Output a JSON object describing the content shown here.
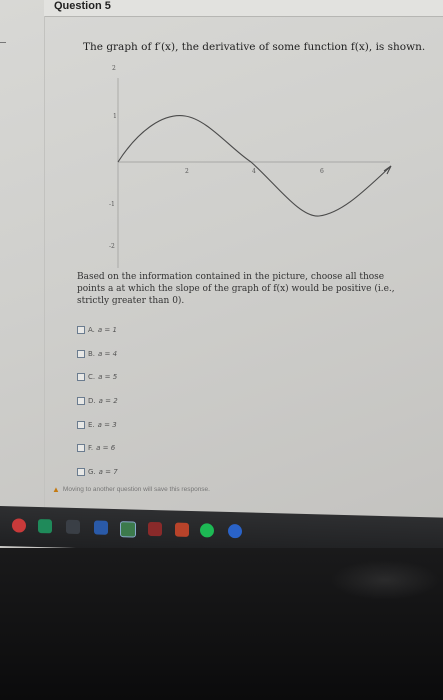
{
  "header": {
    "title": "Question 5"
  },
  "question": {
    "prompt": "The graph of f′(x), the derivative of some function f(x), is shown.",
    "instructions": "Based on the information contained in the picture, choose all those points a at which the slope of the graph of f(x) would be positive (i.e., strictly greater than 0)."
  },
  "graph": {
    "y_ticks": [
      "2",
      "1",
      "-1",
      "-2"
    ],
    "x_ticks": [
      "2",
      "4",
      "6"
    ]
  },
  "choices": [
    {
      "letter": "A.",
      "expr": "a = 1"
    },
    {
      "letter": "B.",
      "expr": "a = 4"
    },
    {
      "letter": "C.",
      "expr": "a = 5"
    },
    {
      "letter": "D.",
      "expr": "a = 2"
    },
    {
      "letter": "E.",
      "expr": "a = 3"
    },
    {
      "letter": "F.",
      "expr": "a = 6"
    },
    {
      "letter": "G.",
      "expr": "a = 7"
    }
  ],
  "footer": {
    "warning": "Moving to another question will save this response.",
    "warning_icon": "warning-icon"
  },
  "taskbar": {
    "icons": [
      "windows-icon",
      "app-green-icon",
      "app-dark-icon",
      "app-word-icon",
      "app-photos-icon",
      "app-red-icon",
      "app-file-icon",
      "app-spotify-icon",
      "app-blue-icon"
    ]
  }
}
